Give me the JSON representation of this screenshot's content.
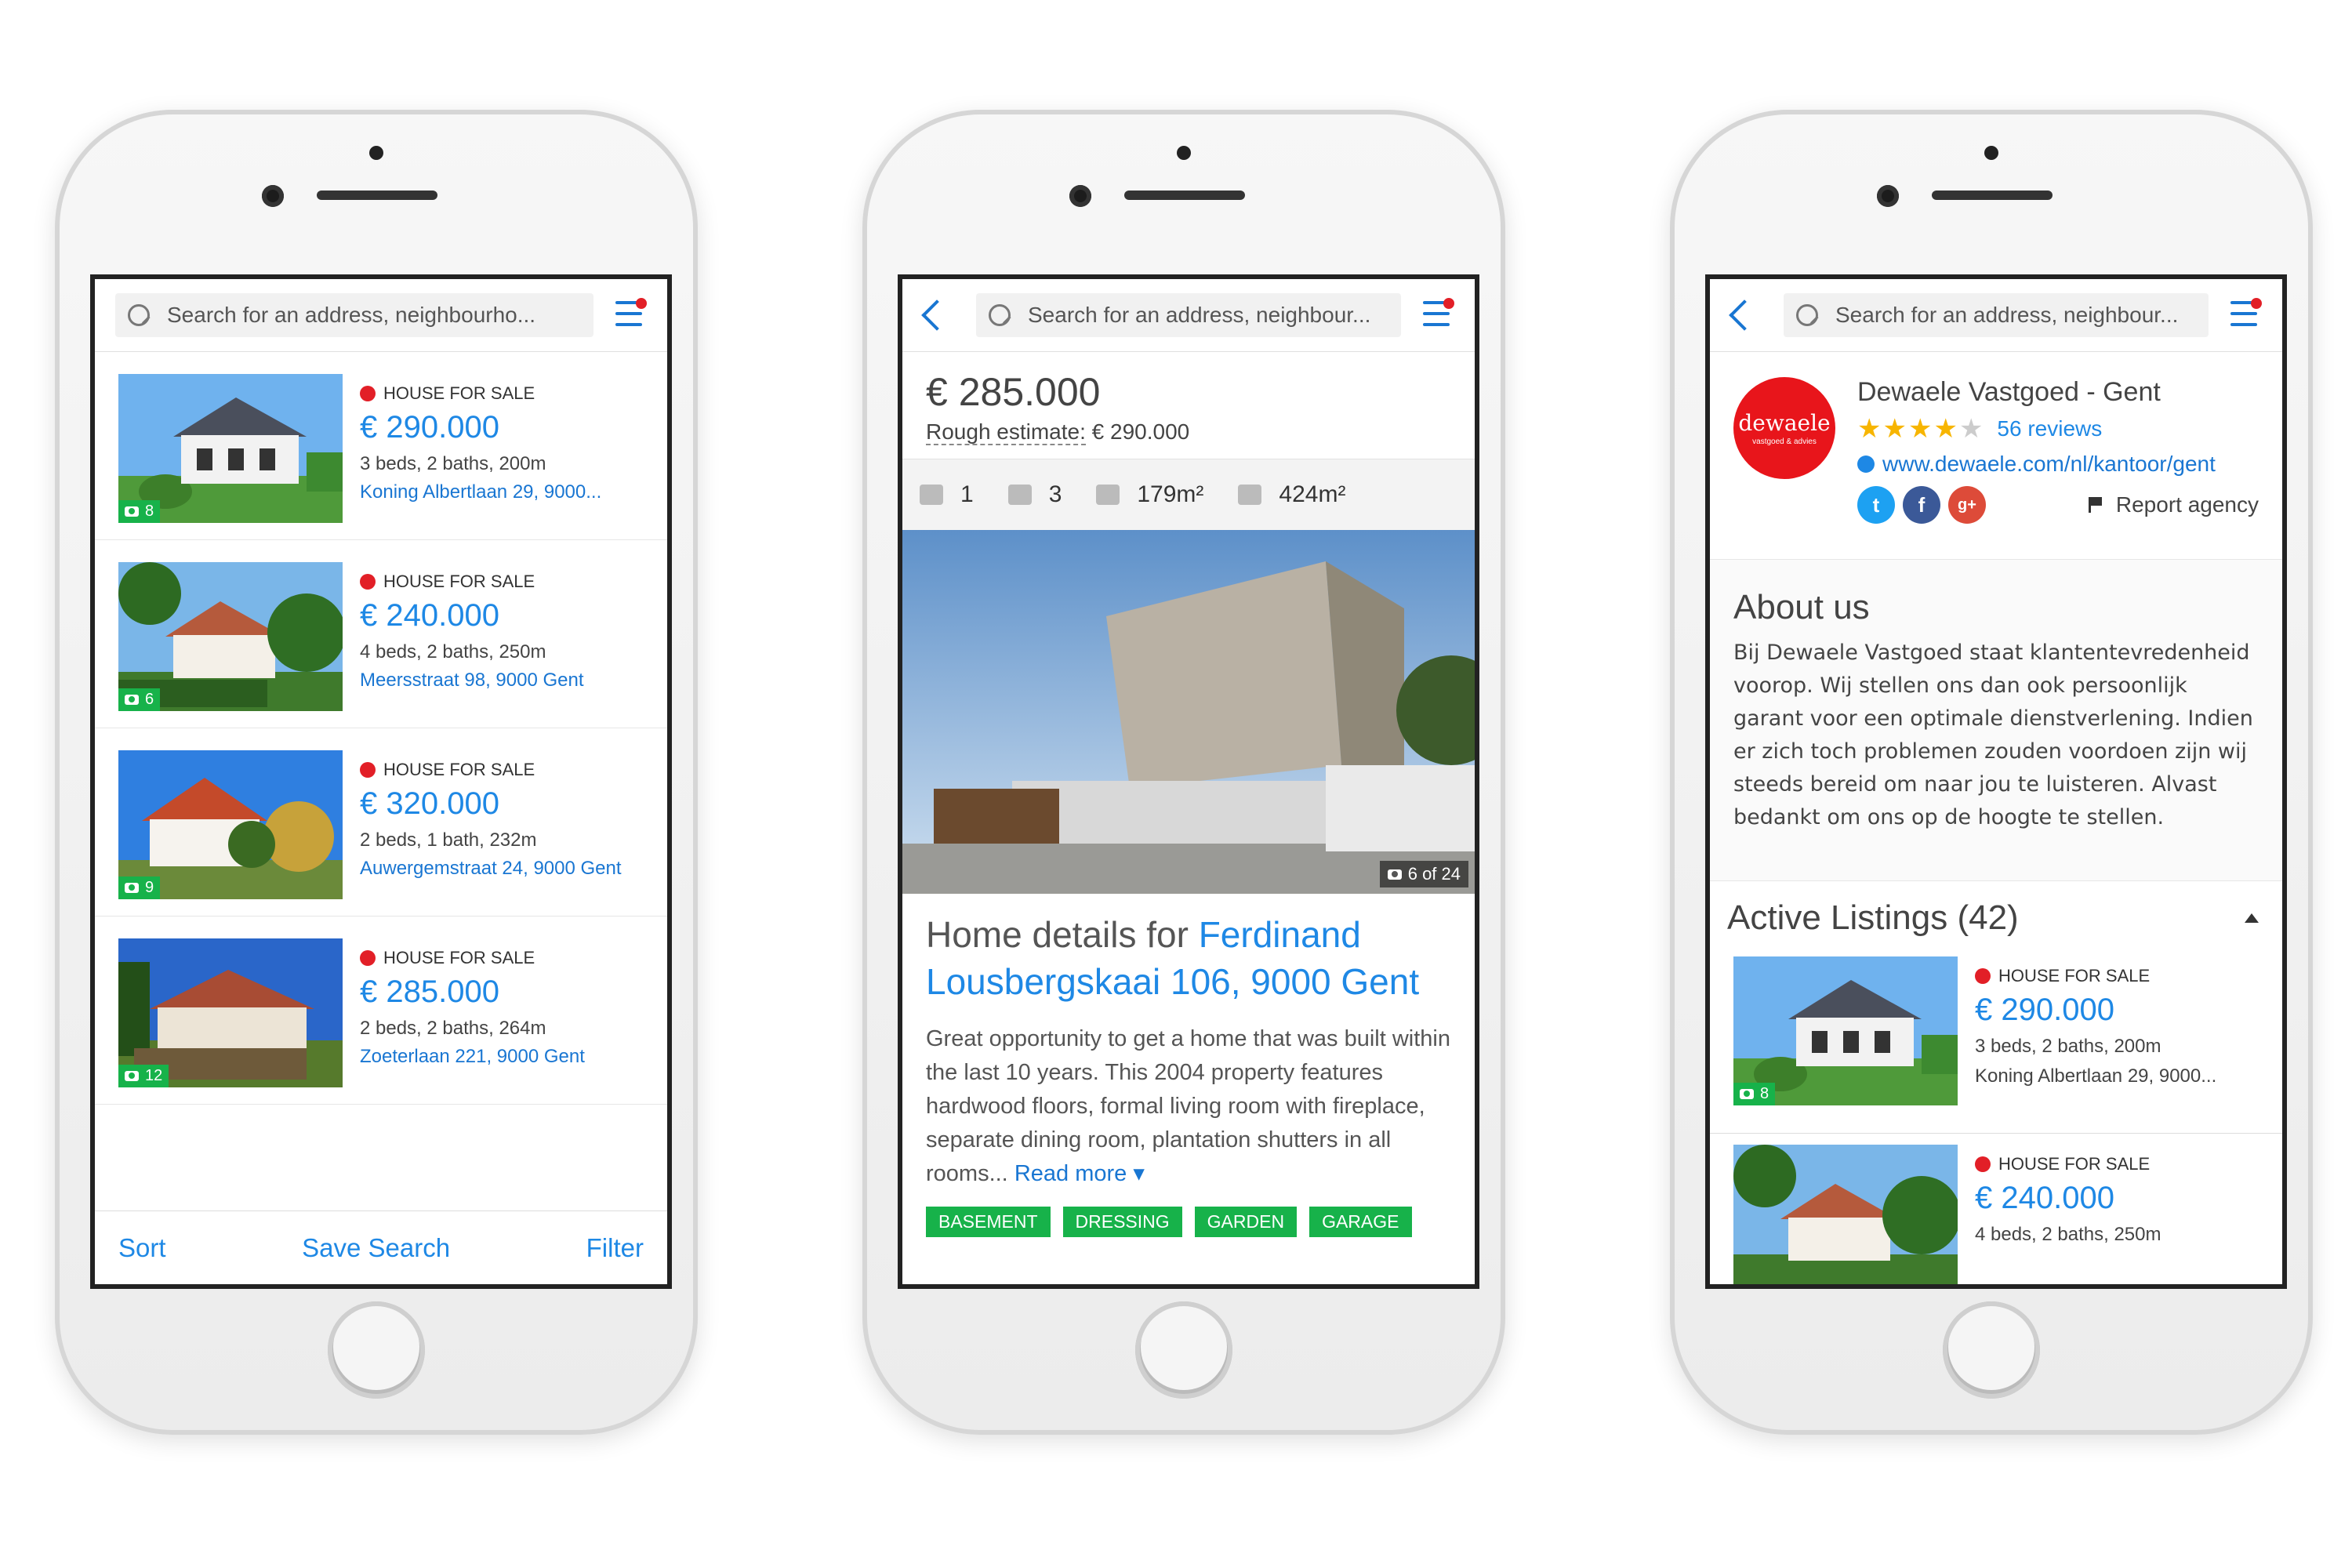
{
  "phone1": {
    "search_placeholder": "Search for an address, neighbourho...",
    "listings": [
      {
        "type": "HOUSE FOR SALE",
        "price": "€ 290.000",
        "specs": "3 beds, 2 baths, 200m",
        "address": "Koning Albertlaan 29, 9000...",
        "photos": "8"
      },
      {
        "type": "HOUSE FOR SALE",
        "price": "€ 240.000",
        "specs": "4 beds, 2 baths, 250m",
        "address": "Meersstraat 98, 9000 Gent",
        "photos": "6"
      },
      {
        "type": "HOUSE FOR SALE",
        "price": "€ 320.000",
        "specs": "2 beds, 1 bath, 232m",
        "address": "Auwergemstraat 24, 9000 Gent",
        "photos": "9"
      },
      {
        "type": "HOUSE FOR SALE",
        "price": "€ 285.000",
        "specs": "2 beds, 2 baths, 264m",
        "address": "Zoeterlaan 221, 9000 Gent",
        "photos": "12"
      }
    ],
    "bottom": {
      "sort": "Sort",
      "save": "Save Search",
      "filter": "Filter"
    }
  },
  "phone2": {
    "search_placeholder": "Search for an address, neighbour...",
    "price": "€ 285.000",
    "estimate_label": "Rough estimate:",
    "estimate_value": "€ 290.000",
    "stats": {
      "bath": "1",
      "beds": "3",
      "living": "179m²",
      "plot": "424m²"
    },
    "photo_counter": "6 of 24",
    "title_prefix": "Home details for",
    "title_address": "Ferdinand Lousbergskaai 106, 9000 Gent",
    "description": "Great opportunity to get a home that was built within the last 10 years. This 2004 property features hardwood floors, formal living room with fireplace, separate dining room, plantation shutters in all rooms...",
    "read_more": "Read more ▾",
    "chips": [
      "BASEMENT",
      "DRESSING",
      "GARDEN",
      "GARAGE"
    ]
  },
  "phone3": {
    "search_placeholder": "Search for an address, neighbour...",
    "logo_text": "dewaele",
    "logo_sub": "vastgoed & advies",
    "agency_name": "Dewaele Vastgoed - Gent",
    "rating": 4,
    "reviews": "56 reviews",
    "website": "www.dewaele.com/nl/kantoor/gent",
    "report": "Report agency",
    "about_title": "About us",
    "about_text": "Bij Dewaele Vastgoed staat klantentevredenheid voorop. Wij stellen ons dan ook persoonlijk garant voor een optimale dienstverlening. Indien er zich toch problemen zouden voordoen zijn wij steeds bereid om naar jou te luisteren. Alvast bedankt om ons op de hoogte te stellen.",
    "active_listings": "Active Listings (42)",
    "listings": [
      {
        "type": "HOUSE FOR SALE",
        "price": "€ 290.000",
        "specs": "3 beds, 2 baths, 200m",
        "address": "Koning Albertlaan 29, 9000...",
        "photos": "8"
      },
      {
        "type": "HOUSE FOR SALE",
        "price": "€ 240.000",
        "specs": "4 beds, 2 baths, 250m",
        "address": "",
        "photos": ""
      }
    ]
  },
  "colors": {
    "accent": "#1e88e5",
    "badge_green": "#17b24a",
    "red_dot": "#e21f27",
    "brand_red": "#e8151b",
    "star": "#f7b500"
  }
}
